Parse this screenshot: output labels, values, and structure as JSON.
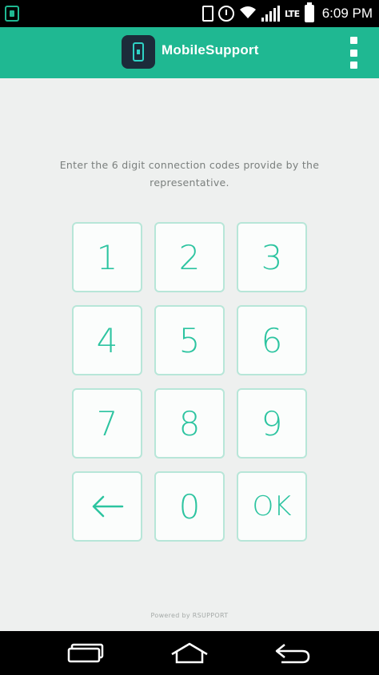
{
  "status_bar": {
    "lte_label": "LTE",
    "time": "6:09 PM",
    "icons": [
      "app-notification-icon",
      "nfc-icon",
      "alarm-icon",
      "wifi-icon",
      "signal-icon",
      "battery-icon"
    ]
  },
  "app_bar": {
    "title": "MobileSupport",
    "logo_icon": "phone-logo-icon",
    "menu_icon": "overflow-menu-icon"
  },
  "instruction": "Enter the 6 digit connection codes provide by the representative.",
  "keypad": {
    "keys": [
      "1",
      "2",
      "3",
      "4",
      "5",
      "6",
      "7",
      "8",
      "9",
      "back-arrow-icon",
      "0",
      "OK"
    ],
    "ok_label": "OK"
  },
  "footer": {
    "powered_by": "Powered by RSUPPORT"
  },
  "nav_bar": {
    "icons": [
      "recent-apps-icon",
      "home-icon",
      "back-icon"
    ]
  },
  "colors": {
    "accent": "#1fb892",
    "key_text": "#2cc4a0",
    "key_border": "#b7e6d8",
    "background": "#eef0ef"
  }
}
